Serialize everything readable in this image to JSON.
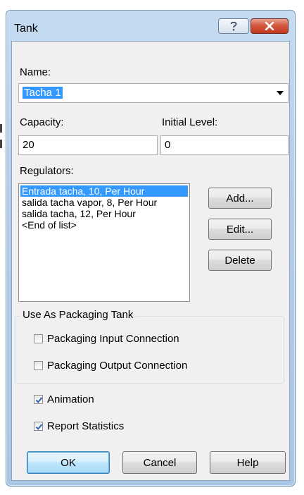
{
  "window": {
    "title": "Tank",
    "help_glyph": "?",
    "close_glyph": "X"
  },
  "name_field": {
    "label": "Name:",
    "value": "Tacha 1"
  },
  "capacity_field": {
    "label": "Capacity:",
    "value": "20"
  },
  "initial_level_field": {
    "label": "Initial Level:",
    "value": "0"
  },
  "regulators": {
    "label": "Regulators:",
    "items": [
      {
        "text": "Entrada tacha, 10, Per Hour",
        "selected": true
      },
      {
        "text": "salida tacha vapor, 8, Per Hour",
        "selected": false
      },
      {
        "text": "salida tacha, 12, Per Hour",
        "selected": false
      },
      {
        "text": "<End of list>",
        "selected": false
      }
    ],
    "add_label": "Add...",
    "edit_label": "Edit...",
    "delete_label": "Delete"
  },
  "packaging_group": {
    "title": "Use As Packaging Tank",
    "input_connection": {
      "label": "Packaging Input Connection",
      "checked": false
    },
    "output_connection": {
      "label": "Packaging Output Connection",
      "checked": false
    }
  },
  "options": {
    "animation": {
      "label": "Animation",
      "checked": true
    },
    "report_statistics": {
      "label": "Report Statistics",
      "checked": true
    }
  },
  "footer": {
    "ok_label": "OK",
    "cancel_label": "Cancel",
    "help_label": "Help"
  },
  "colors": {
    "selection": "#3399ff",
    "close_button": "#c13a20",
    "title_bar": "#b3cde9",
    "check_mark": "#2b5fb0"
  }
}
